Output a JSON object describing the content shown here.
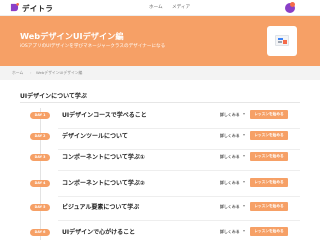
{
  "header": {
    "logo_text": "デイトラ",
    "nav": [
      "ホーム",
      "メディア"
    ],
    "avatar_color": "#8a3fc7"
  },
  "hero": {
    "title": "WebデザインUIデザイン編",
    "subtitle": "iOSアプリのUIデザインを学びマネージャークラスのデザイナーになる",
    "background": "#f6a066"
  },
  "breadcrumb": [
    "ホーム",
    "WebデザインUIデザイン編"
  ],
  "section": {
    "title": "UIデザインについて学ぶ"
  },
  "lessons": [
    {
      "day": "DAY 1",
      "title": "UIデザインコースで学べること",
      "detail": "詳しくみる",
      "action": "レッスンを始める"
    },
    {
      "day": "DAY 2",
      "title": "デザインツールについて",
      "detail": "詳しくみる",
      "action": "レッスンを始める"
    },
    {
      "day": "DAY 3",
      "title": "コンポーネントについて学ぶ①",
      "detail": "詳しくみる",
      "action": "レッスンを始める"
    },
    {
      "day": "DAY 4",
      "title": "コンポーネントについて学ぶ②",
      "detail": "詳しくみる",
      "action": "レッスンを始める"
    },
    {
      "day": "DAY 5",
      "title": "ビジュアル要素について学ぶ",
      "detail": "詳しくみる",
      "action": "レッスンを始める"
    },
    {
      "day": "DAY 6",
      "title": "UIデザインで心がけること",
      "detail": "詳しくみる",
      "action": "レッスンを始める"
    }
  ],
  "accent_color": "#f6a066"
}
